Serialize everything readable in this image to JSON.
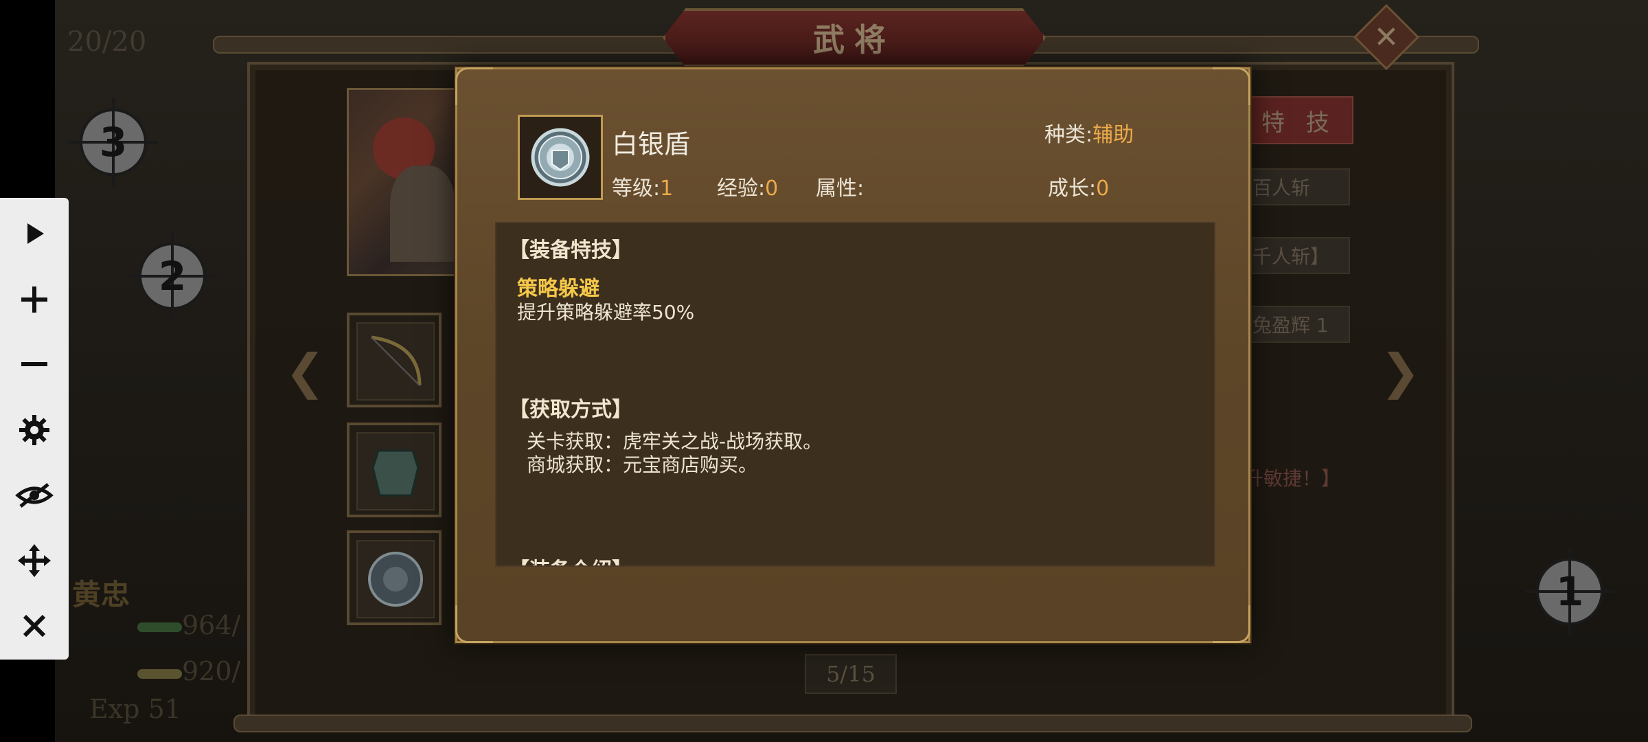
{
  "game": {
    "window_title": "武将",
    "close_icon": "close-icon",
    "count": "20/20",
    "page_indicator": "5/15"
  },
  "hero": {
    "name": "黄忠",
    "hp": "964/",
    "mp": "920/",
    "exp": "Exp 51"
  },
  "side_panel": {
    "tab_label": "特 技",
    "skills": [
      "百人斩",
      "千人斩】",
      "兔盈辉 1"
    ],
    "note": "升敏捷！】"
  },
  "overlay": {
    "targets": [
      "3",
      "2",
      "1"
    ],
    "toolbar_icons": [
      "play-icon",
      "plus-icon",
      "minus-icon",
      "gear-icon",
      "eye-off-icon",
      "move-icon",
      "close-icon"
    ]
  },
  "item": {
    "icon": "silver-shield-icon",
    "name": "白银盾",
    "type_label": "种类:",
    "type_value": "辅助",
    "level_label": "等级:",
    "level_value": "1",
    "exp_label": "经验:",
    "exp_value": "0",
    "attr_label": "属性:",
    "growth_label": "成长:",
    "growth_value": "0"
  },
  "details": {
    "skill_section_title": "【装备特技】",
    "skill_name": "策略躲避",
    "skill_desc": "提升策略躲避率50%",
    "source_section_title": "【获取方式】",
    "sources": [
      "关卡获取：虎牢关之战-战场获取。",
      "商城获取：元宝商店购买。"
    ],
    "cut_section_title": "【装备介绍】"
  },
  "colors": {
    "accent_value": "#ecaa4c",
    "skill_name": "#f5c84a",
    "dialog_bg": "#5d4528",
    "dialog_border": "#a8854a"
  }
}
